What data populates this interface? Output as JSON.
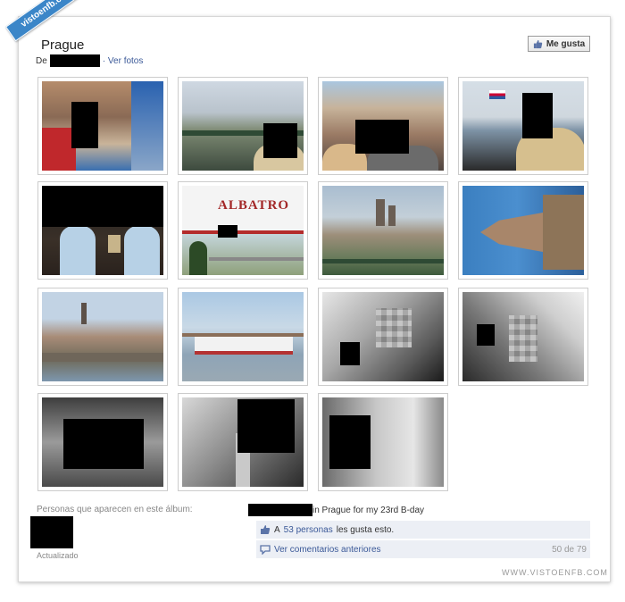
{
  "badge": "vistoenfb.com",
  "album": {
    "title": "Prague",
    "by_prefix": "De",
    "see_photos": "· Ver fotos",
    "like_button": "Me gusta"
  },
  "people": {
    "label": "Personas que aparecen en este álbum:",
    "updated": "Actualizado"
  },
  "caption": "in Prague for my 23rd B-day",
  "likes": {
    "prefix": "A",
    "count_link": "53 personas",
    "suffix": "les gusta esto."
  },
  "comments": {
    "link": "Ver comentarios anteriores",
    "count": "50 de 79"
  },
  "watermark": "WWW.VISTOENFB.COM",
  "thumb_scene": "ALBATRO",
  "colors": {
    "accent": "#3b5998",
    "badge": "#3b86c8",
    "panel": "#eceff5"
  },
  "icons": {
    "like": "thumbs-up-icon",
    "comment": "speech-bubble-icon"
  }
}
